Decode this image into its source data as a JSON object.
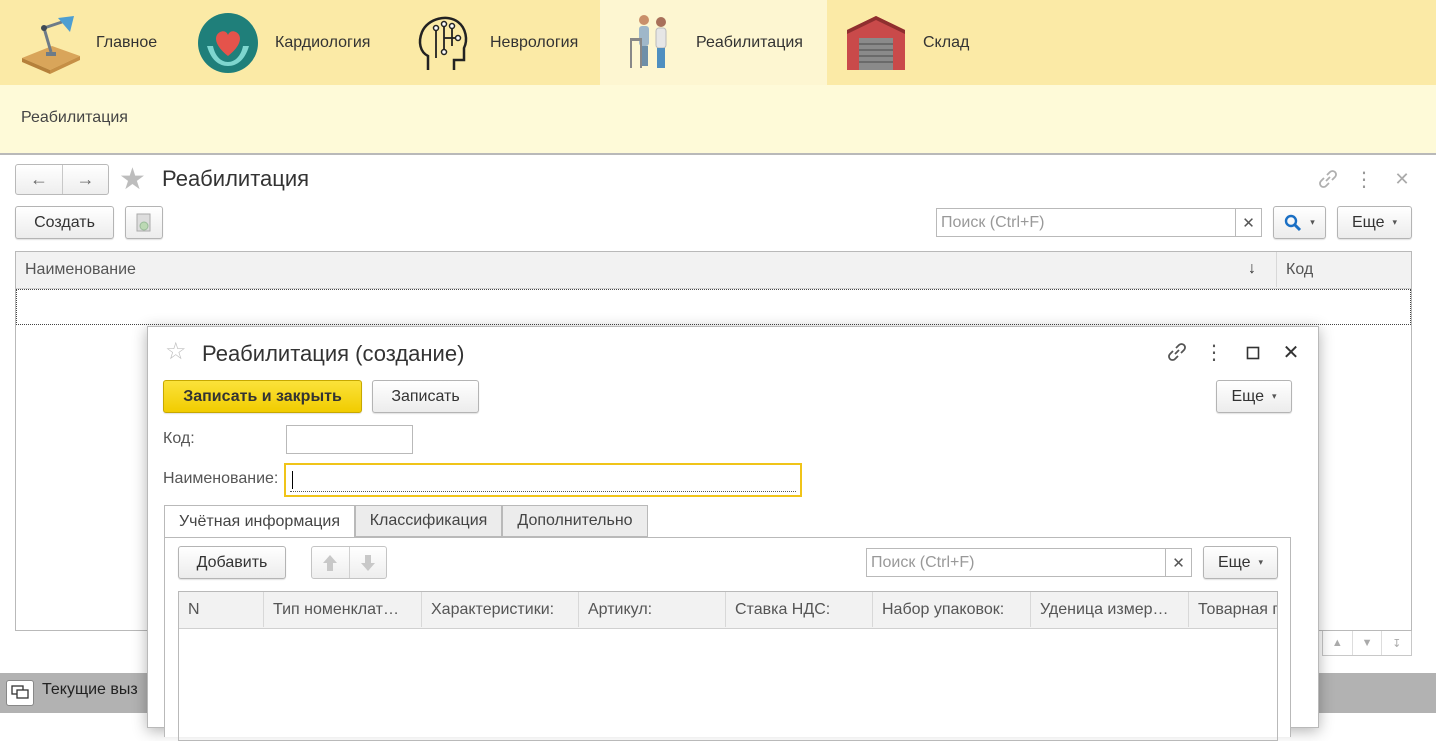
{
  "nav": {
    "items": [
      {
        "label": "Главное",
        "icon": "desk-lamp-icon"
      },
      {
        "label": "Кардиология",
        "icon": "heart-hands-icon"
      },
      {
        "label": "Неврология",
        "icon": "brain-circuit-icon"
      },
      {
        "label": "Реабилитация",
        "icon": "walker-patient-icon"
      },
      {
        "label": "Склад",
        "icon": "warehouse-icon"
      }
    ],
    "active": "Реабилитация"
  },
  "section": {
    "title": "Реабилитация"
  },
  "list_window": {
    "title": "Реабилитация",
    "create_label": "Создать",
    "search_placeholder": "Поиск (Ctrl+F)",
    "more_label": "Еще",
    "columns": [
      "Наименование",
      "Код"
    ],
    "sort_indicator": "↓"
  },
  "dialog": {
    "title": "Реабилитация (создание)",
    "save_close_label": "Записать и закрыть",
    "save_label": "Записать",
    "more_label": "Еще",
    "code_label": "Код:",
    "code_value": "",
    "name_label": "Наименование:",
    "name_value": "",
    "tabs": [
      "Учётная информация",
      "Классификация",
      "Дополнительно"
    ],
    "active_tab": "Учётная информация",
    "add_label": "Добавить",
    "search_placeholder": "Поиск (Ctrl+F)",
    "table_more_label": "Еще",
    "columns": [
      "N",
      "Тип номенклат…",
      "Характеристики:",
      "Артикул:",
      "Ставка НДС:",
      "Набор упаковок:",
      "Уденица измер…",
      "Товарная г"
    ]
  },
  "taskbar": {
    "label": "Текущие выз"
  },
  "colors": {
    "nav_bg": "#fbeaa6",
    "section_bg": "#fefad8",
    "primary": "#f5d311",
    "focus": "#f0c419"
  }
}
